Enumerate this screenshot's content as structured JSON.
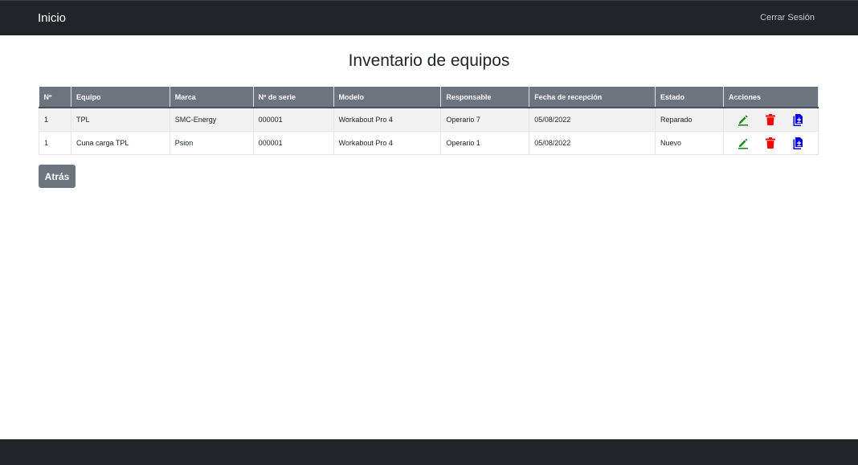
{
  "navbar": {
    "brand": "Inicio",
    "logout": "Cerrar Sesión"
  },
  "title": "Inventario de equipos",
  "table": {
    "headers": [
      "Nº",
      "Equipo",
      "Marca",
      "Nº de serie",
      "Modelo",
      "Responsable",
      "Fecha de recepción",
      "Estado",
      "Acciones"
    ],
    "rows": [
      [
        "1",
        "TPL",
        "SMC-Energy",
        "000001",
        "Workabout Pro 4",
        "Operario 7",
        "05/08/2022",
        "Reparado"
      ],
      [
        "1",
        "Cuna carga TPL",
        "Psion",
        "000001",
        "Workabout Pro 4",
        "Operario 1",
        "05/08/2022",
        "Nuevo"
      ]
    ]
  },
  "actions": {
    "edit_icon": "pencil-icon",
    "delete_icon": "trash-icon",
    "doc_icon": "document-add-icon"
  },
  "colors": {
    "navbar": "#212529",
    "header": "#6c757d",
    "edit": "#1e8c1e",
    "delete": "#ff0000",
    "doc": "#0000ee"
  },
  "back_button": "Atrás"
}
